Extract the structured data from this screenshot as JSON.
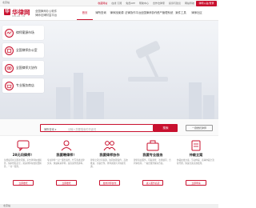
{
  "topbar": {
    "location": "北京站",
    "links": [
      "收藏网站",
      "在线 订阅",
      "免费APP",
      "帮助中心",
      "合作法律家",
      "投诉与建议",
      "网站导航"
    ],
    "login_label": "律师入驻/登录"
  },
  "header": {
    "logo_mark": "华",
    "logo_name": "华律网",
    "logo_domain": "66LAW.CN",
    "slogan_line1": "全国律师办公软件",
    "slogan_line2": "律师法律财富平台"
  },
  "nav": {
    "items": [
      "首页",
      "律所查询",
      "律师找案源",
      "法律协作平台",
      "全国律师协作",
      "资产管理系统",
      "案件工具",
      "律师社区"
    ]
  },
  "hero": {
    "cards": [
      {
        "label": "律师案源市场",
        "icon": "handshake-icon"
      },
      {
        "label": "全国律师办公室",
        "icon": "office-icon"
      },
      {
        "label": "全国律师大协作",
        "icon": "collaboration-icon"
      },
      {
        "label": "专业服务商店",
        "icon": "store-icon"
      }
    ]
  },
  "search": {
    "category": "律所查询 ▾",
    "placeholder": "请输入您要搜索的关键词",
    "button_label": "搜索",
    "feedback_label": "一键委托律师"
  },
  "services": [
    {
      "title": "28元问律师！",
      "desc": "免费提问时无限次问题，平台律师在线解答，保护隐私安全，资深律师在线免费解答，一对一服务。",
      "button": "立即委托",
      "icon": "chat-icon"
    },
    {
      "title": "我要聘律师！",
      "desc": "专业律师一对一服务案件，代写各类法律文书，快速联系律师，提高案件胜诉率。",
      "button": "立即委托",
      "icon": "person-icon"
    },
    {
      "title": "我要律师协作",
      "desc": "律师之间分享案源，协同办理案件，高效推进，共赢合作，律师资源共享快捷互通。",
      "button": "发布律师协作",
      "icon": "team-icon"
    },
    {
      "title": "我要专业服务",
      "desc": "律师专业服务，尽职调查、法律顾问、合同审核等，一站式服务解决方案。",
      "button": "进入服务商店",
      "icon": "briefcase-icon"
    },
    {
      "title": "仲裁立案",
      "desc": "仲裁在线立案，劳动仲裁、商事仲裁全流程代理，快速立案高效处理。",
      "button": "立即申请",
      "icon": "document-icon"
    }
  ],
  "footer": {
    "location": "北京站"
  },
  "colors": {
    "brand": "#c8102e",
    "hero_bg": "#eef0f4"
  }
}
